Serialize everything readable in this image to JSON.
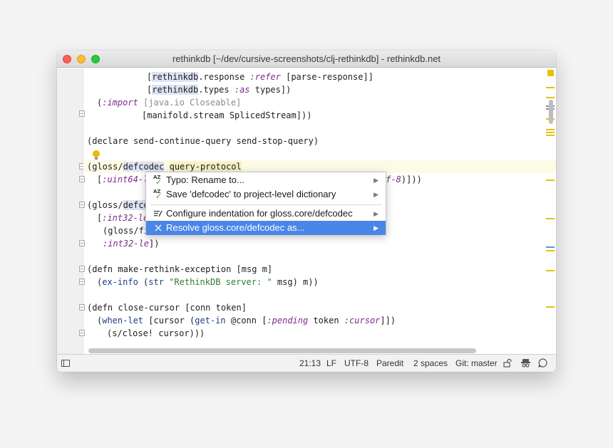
{
  "window": {
    "title": "rethinkdb [~/dev/cursive-screenshots/clj-rethinkdb] - rethinkdb.net"
  },
  "code": {
    "l1": [
      "[",
      "rethinkdb",
      ".response ",
      ":refer",
      " [parse-response]]"
    ],
    "l2": [
      "[",
      "rethinkdb",
      ".types ",
      ":as",
      " types])"
    ],
    "l3": [
      "(",
      ":import",
      " [java.io Closeable]"
    ],
    "l4": "[manifold.stream SplicedStream]))",
    "l5": "(declare send-continue-query send-stop-query)",
    "l6": [
      "(gloss/",
      "defcodec",
      " ",
      "query-protocol"
    ],
    "l7": [
      "[",
      ":uint64-l",
      "tf-8",
      ")]))"
    ],
    "l8": [
      "(gloss/",
      "defco"
    ],
    "l9": [
      "[",
      ":int32-le"
    ],
    "l10": "(gloss/fi",
    "l11": [
      ":int32-le",
      "])"
    ],
    "l12": "(defn make-rethink-exception [msg m]",
    "l13": [
      "(",
      "ex-info",
      " (",
      "str",
      " ",
      "\"RethinkDB server: \"",
      " msg) m))"
    ],
    "l14": "(defn close-cursor [conn token]",
    "l15": [
      "(",
      "when-let",
      " [cursor (",
      "get-in",
      " @conn [",
      ":pending",
      " token ",
      ":cursor",
      "]])"
    ],
    "l16": [
      "(s/close! cursor)))"
    ]
  },
  "popup": {
    "items": [
      {
        "label": "Typo: Rename to...",
        "icon": "spellcheck-icon"
      },
      {
        "label": "Save 'defcodec' to project-level dictionary",
        "icon": "spellcheck-icon"
      },
      {
        "label": "Configure indentation for gloss.core/defcodec",
        "icon": "indent-icon"
      },
      {
        "label": "Resolve gloss.core/defcodec as...",
        "icon": "resolve-icon"
      }
    ],
    "az": "AZ",
    "check": "✓",
    "arrow": "▶",
    "selection_color": "#4a86e8"
  },
  "status": {
    "position": "21:13",
    "line_separator": "LF",
    "encoding": "UTF-8",
    "mode": "Paredit",
    "indent": "2 spaces",
    "vcs": "Git: master"
  },
  "colors": {
    "warning_marker": "#e8c000",
    "keyword": "#7b2c8c",
    "string": "#2e7d2e"
  }
}
